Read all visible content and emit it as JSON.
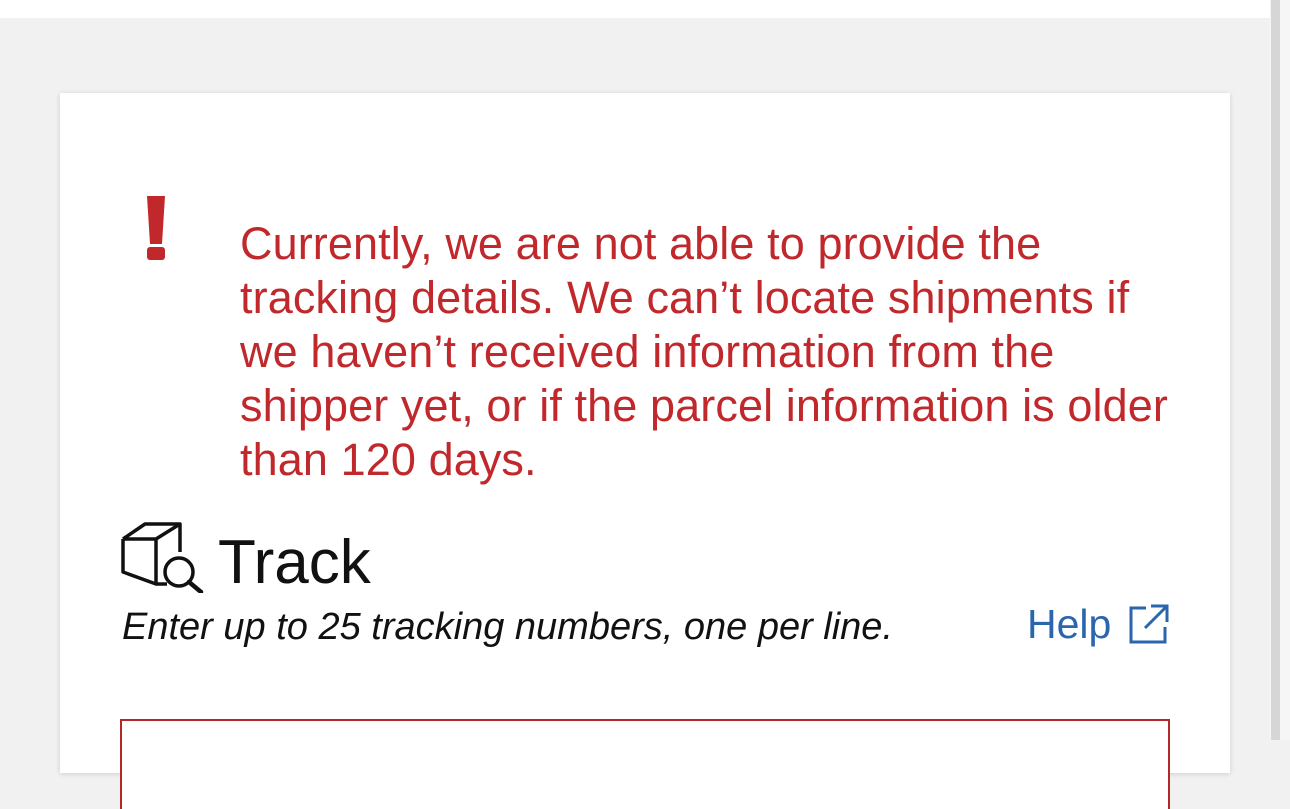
{
  "alert": {
    "icon": "exclamation-icon",
    "message": "Currently, we are not able to provide the tracking details. We can’t locate shipments if we haven’t received information from the shipper yet, or if the parcel information is older than 120 days.",
    "color": "#c0282c"
  },
  "track": {
    "icon": "package-search-icon",
    "title": "Track",
    "instructions": "Enter up to 25 tracking numbers, one per line.",
    "help_label": "Help",
    "help_icon": "external-link-icon",
    "link_color": "#2a65ad",
    "input_border_color": "#b3262b",
    "input_value": ""
  }
}
